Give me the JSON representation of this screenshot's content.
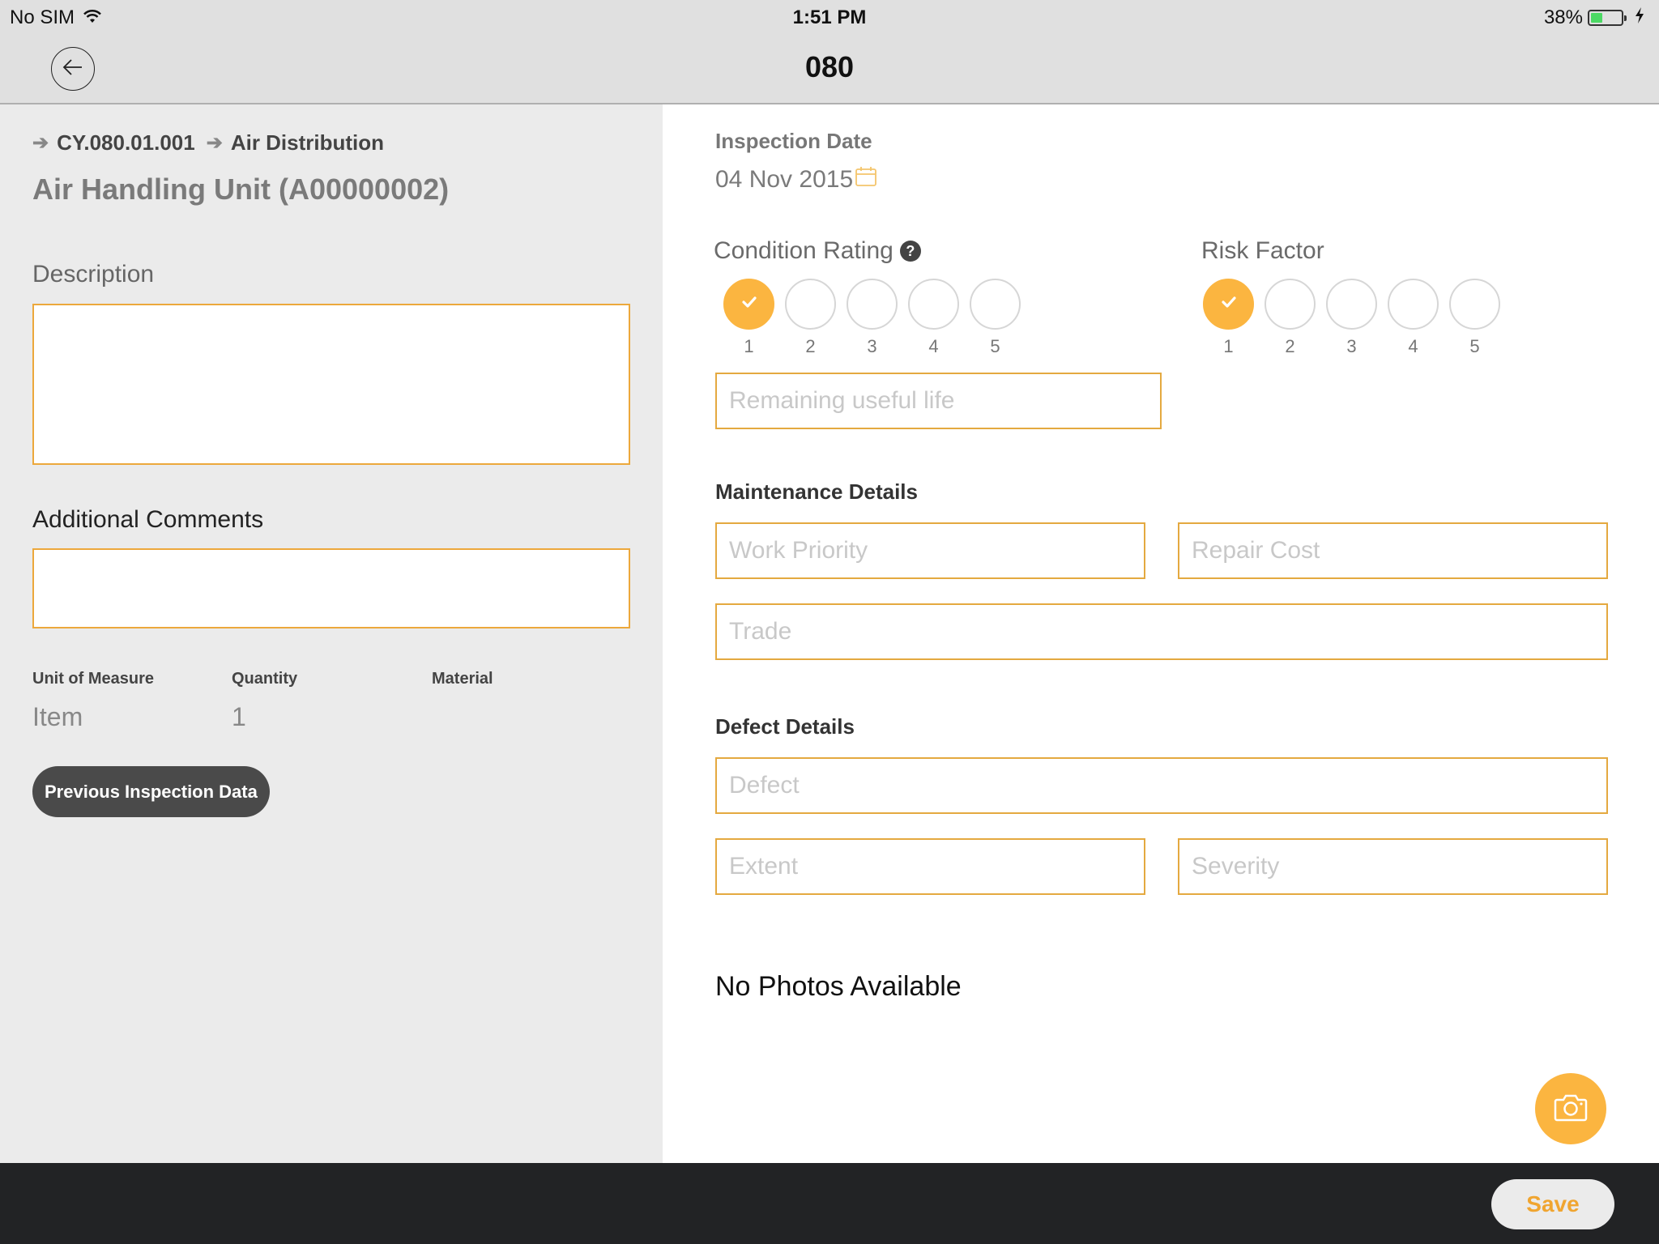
{
  "status_bar": {
    "carrier": "No SIM",
    "time": "1:51 PM",
    "battery_percent_label": "38%",
    "battery_level": 0.38,
    "charging": true
  },
  "nav": {
    "title": "080",
    "back_icon": "arrow-left-icon"
  },
  "left": {
    "breadcrumb": [
      "CY.080.01.001",
      "Air Distribution"
    ],
    "asset_title": "Air Handling Unit (A00000002)",
    "description_label": "Description",
    "description_value": "",
    "comments_label": "Additional Comments",
    "comments_value": "",
    "meta": {
      "unit_label": "Unit of Measure",
      "unit_value": "Item",
      "quantity_label": "Quantity",
      "quantity_value": "1",
      "material_label": "Material",
      "material_value": ""
    },
    "previous_button": "Previous Inspection Data"
  },
  "right": {
    "inspection_date_label": "Inspection Date",
    "inspection_date_value": "04 Nov 2015",
    "condition_rating": {
      "label": "Condition Rating",
      "help": "?",
      "options": [
        "1",
        "2",
        "3",
        "4",
        "5"
      ],
      "selected": "1"
    },
    "risk_factor": {
      "label": "Risk Factor",
      "options": [
        "1",
        "2",
        "3",
        "4",
        "5"
      ],
      "selected": "1"
    },
    "remaining_life_placeholder": "Remaining useful life",
    "maintenance": {
      "title": "Maintenance Details",
      "work_priority_placeholder": "Work Priority",
      "repair_cost_placeholder": "Repair Cost",
      "trade_placeholder": "Trade"
    },
    "defect": {
      "title": "Defect Details",
      "defect_placeholder": "Defect",
      "extent_placeholder": "Extent",
      "severity_placeholder": "Severity"
    },
    "photos_empty": "No Photos Available"
  },
  "footer": {
    "save_label": "Save"
  },
  "colors": {
    "accent": "#fbb540",
    "input_border": "#e4a940",
    "footer_bg": "#222325",
    "left_panel_bg": "#ebebeb"
  }
}
